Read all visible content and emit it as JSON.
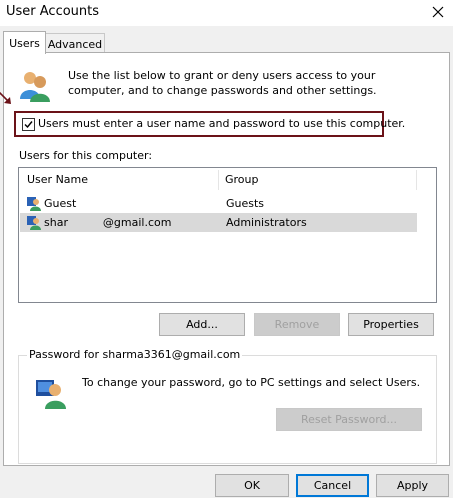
{
  "window": {
    "title": "User Accounts"
  },
  "tabs": [
    {
      "label": "Users",
      "active": true
    },
    {
      "label": "Advanced",
      "active": false
    }
  ],
  "intro_text": "Use the list below to grant or deny users access to your computer, and to change passwords and other settings.",
  "require_login": {
    "label": "Users must enter a user name and password to use this computer.",
    "checked": true
  },
  "users_list": {
    "label": "Users for this computer:",
    "columns": [
      "User Name",
      "Group"
    ],
    "rows": [
      {
        "name": "Guest",
        "group": "Guests",
        "selected": false
      },
      {
        "name": "shar          @gmail.com",
        "group": "Administrators",
        "selected": true
      }
    ]
  },
  "buttons": {
    "add": "Add...",
    "remove": "Remove",
    "properties": "Properties",
    "reset_password": "Reset Password...",
    "ok": "OK",
    "cancel": "Cancel",
    "apply": "Apply"
  },
  "password_group": {
    "title": "Password for sharma3361@gmail.com",
    "text": "To change your password, go to PC settings and select Users."
  },
  "colors": {
    "highlight_frame": "#6b1218",
    "selected_row": "#d9d9d9",
    "default_button_border": "#0078d7"
  }
}
